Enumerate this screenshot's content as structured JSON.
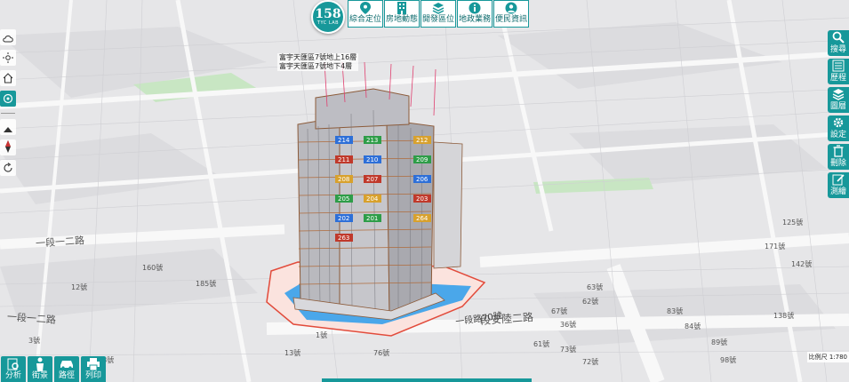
{
  "brand": {
    "number": "158",
    "subtitle": "TYC LAB"
  },
  "toolbar": [
    {
      "label": "綜合定位",
      "icon": "map-pin-icon"
    },
    {
      "label": "房地動態",
      "icon": "building-icon"
    },
    {
      "label": "開發區位",
      "icon": "layers-icon"
    },
    {
      "label": "地政業務",
      "icon": "info-icon"
    },
    {
      "label": "便民資訊",
      "icon": "user-icon"
    }
  ],
  "left_controls": [
    {
      "name": "weather",
      "icon": "cloud-icon"
    },
    {
      "name": "sun",
      "icon": "sun-icon"
    },
    {
      "name": "home",
      "icon": "home-icon"
    },
    {
      "name": "rotate",
      "icon": "orbit-icon",
      "active": true
    },
    {
      "name": "tilt",
      "icon": "tilt-icon"
    },
    {
      "name": "compass",
      "icon": "compass-icon"
    },
    {
      "name": "reset",
      "icon": "refresh-icon"
    }
  ],
  "right_tools": [
    {
      "label": "搜尋",
      "icon": "search-icon"
    },
    {
      "label": "歷程",
      "icon": "history-icon"
    },
    {
      "label": "圖層",
      "icon": "layers-icon"
    },
    {
      "label": "設定",
      "icon": "gear-icon"
    },
    {
      "label": "刪除",
      "icon": "trash-icon"
    },
    {
      "label": "測繪",
      "icon": "pencil-icon"
    }
  ],
  "bottom_tools": [
    {
      "label": "分析",
      "icon": "analysis-icon"
    },
    {
      "label": "街景",
      "icon": "person-icon"
    },
    {
      "label": "路徑",
      "icon": "car-icon"
    },
    {
      "label": "列印",
      "icon": "printer-icon"
    }
  ],
  "scale": "比例尺 1:780",
  "map_labels": {
    "street_upper": "一段一二路",
    "street_lower": "一段一二路",
    "road_main": "段安陸二路",
    "addr_70": "一段路70號",
    "building_title_1": "富宇天匯區7號地上16層",
    "building_title_2": "富宇天匯區7號地下4層",
    "lots": [
      "73號",
      "72號",
      "67號",
      "61號",
      "13號",
      "1號",
      "3號",
      "38號",
      "138號",
      "142號",
      "125號",
      "171號",
      "160號",
      "185號",
      "12號",
      "76號",
      "36號",
      "83號",
      "84號",
      "89號",
      "98號",
      "63號",
      "62號"
    ]
  },
  "unit_labels": [
    "214",
    "213",
    "212",
    "211",
    "210",
    "209",
    "208",
    "207",
    "206",
    "205",
    "204",
    "203",
    "202",
    "201",
    "264",
    "263"
  ],
  "colors": {
    "accent": "#17989a",
    "road": "#f7f7f7",
    "park": "#c8e6c3"
  }
}
